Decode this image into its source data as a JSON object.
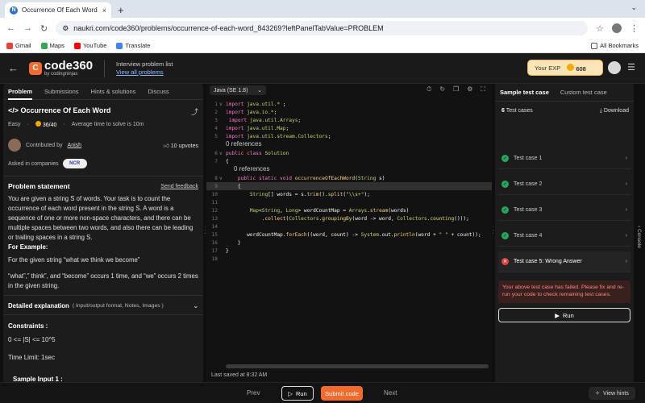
{
  "browser": {
    "tab_title": "Occurrence Of Each Word - N",
    "tab_close": "×",
    "new_tab": "+",
    "url": "naukri.com/code360/problems/occurrence-of-each-word_843269?leftPanelTabValue=PROBLEM",
    "bookmarks": [
      {
        "label": "Gmail",
        "color": "#ea4335"
      },
      {
        "label": "Maps",
        "color": "#34a853"
      },
      {
        "label": "YouTube",
        "color": "#ff0000"
      },
      {
        "label": "Translate",
        "color": "#4285f4"
      }
    ],
    "all_bookmarks": "All Bookmarks"
  },
  "app": {
    "logo_mark": "C",
    "logo_word": "code360",
    "logo_sub": "by codingninjas",
    "interview_list": "Interview problem list",
    "view_all": "View all problems",
    "exp_label": "Your EXP",
    "exp_value": "608"
  },
  "left": {
    "tabs": [
      "Problem",
      "Submissions",
      "Hints & solutions",
      "Discuss"
    ],
    "title": "Occurrence Of Each Word",
    "difficulty": "Easy",
    "score": "36/40",
    "avg_time": "Average time to solve is 10m",
    "contributed_by": "Contributed by",
    "contributor": "Anish",
    "upvotes": "10 upvotes",
    "asked_in": "Asked in companies",
    "company": "NCR",
    "statement_heading": "Problem statement",
    "send_feedback": "Send feedback",
    "statement": "You are given a string S of words. Your task is to count the occurrence of each word present in the string S. A word is a sequence of one or more non-space characters, and there can be multiple spaces between two words, and also there can be leading or trailing spaces in a string S.",
    "example_heading": "For Example:",
    "example_line": "For the given string  “what we think we become”",
    "example_result": "“what”,” think”, and “become” occurs 1 time, and “we” occurs 2 times in the given string.",
    "detailed": "Detailed explanation",
    "detailed_sub": "( Input/output format, Notes, Images )",
    "constraints_heading": "Constraints :",
    "constraint": "0 <= |S| <= 10^5",
    "time_limit": "Time Limit: 1sec",
    "sample_input": "Sample Input 1 :"
  },
  "editor": {
    "language": "Java (SE 1.8)",
    "references_label": "0 references",
    "saved": "Last saved at 8:32 AM",
    "lines": [
      {
        "n": "1",
        "html_parts": [
          [
            "kw",
            "import "
          ],
          [
            "ty",
            "java.util.* "
          ],
          [
            "pl",
            ";"
          ]
        ],
        "fold": "v"
      },
      {
        "n": "2",
        "html_parts": [
          [
            "kw",
            "import "
          ],
          [
            "ty",
            "java.io.*"
          ],
          [
            "pl",
            ";"
          ]
        ]
      },
      {
        "n": "3",
        "html_parts": [
          [
            "kw",
            " import "
          ],
          [
            "ty",
            "java.util.Arrays"
          ],
          [
            "pl",
            ";"
          ]
        ]
      },
      {
        "n": "4",
        "html_parts": [
          [
            "kw",
            "import "
          ],
          [
            "ty",
            "java.util.Map"
          ],
          [
            "pl",
            ";"
          ]
        ]
      },
      {
        "n": "5",
        "html_parts": [
          [
            "kw",
            "import "
          ],
          [
            "ty",
            "java.util.stream.Collectors"
          ],
          [
            "pl",
            ";"
          ]
        ]
      },
      {
        "n": "6",
        "html_parts": [
          [
            "kw",
            "public class "
          ],
          [
            "ty",
            "Solution"
          ]
        ],
        "fold": "v",
        "ref_before": true
      },
      {
        "n": "7",
        "html_parts": [
          [
            "pl",
            "{"
          ]
        ]
      },
      {
        "n": "8",
        "html_parts": [
          [
            "pl",
            "    "
          ],
          [
            "kw",
            "public static void "
          ],
          [
            "fn",
            "occurrenceOfEachWord"
          ],
          [
            "pl",
            "("
          ],
          [
            "ty",
            "String "
          ],
          [
            "pl",
            "s)"
          ]
        ],
        "fold": "v",
        "ref_before": true,
        "ref_indent": true
      },
      {
        "n": "9",
        "html_parts": [
          [
            "pl",
            "    {"
          ]
        ],
        "hl": true
      },
      {
        "n": "10",
        "html_parts": [
          [
            "pl",
            "        "
          ],
          [
            "ty",
            "String"
          ],
          [
            "pl",
            "[] words = s."
          ],
          [
            "fn",
            "trim"
          ],
          [
            "pl",
            "()."
          ],
          [
            "fn",
            "split"
          ],
          [
            "pl",
            "("
          ],
          [
            "st",
            "\"\\\\s+\""
          ],
          [
            "pl",
            ");"
          ]
        ]
      },
      {
        "n": "11",
        "html_parts": [
          [
            "pl",
            ""
          ]
        ]
      },
      {
        "n": "12",
        "html_parts": [
          [
            "pl",
            "        "
          ],
          [
            "ty",
            "Map"
          ],
          [
            "pl",
            "<"
          ],
          [
            "ty",
            "String"
          ],
          [
            "pl",
            ", "
          ],
          [
            "ty",
            "Long"
          ],
          [
            "pl",
            "> wordCountMap = "
          ],
          [
            "ty",
            "Arrays"
          ],
          [
            "pl",
            "."
          ],
          [
            "fn",
            "stream"
          ],
          [
            "pl",
            "(words)"
          ]
        ]
      },
      {
        "n": "13",
        "html_parts": [
          [
            "pl",
            "            ."
          ],
          [
            "fn",
            "collect"
          ],
          [
            "pl",
            "("
          ],
          [
            "ty",
            "Collectors"
          ],
          [
            "pl",
            "."
          ],
          [
            "fn",
            "groupingBy"
          ],
          [
            "pl",
            "(word -> word, "
          ],
          [
            "ty",
            "Collectors"
          ],
          [
            "pl",
            "."
          ],
          [
            "fn",
            "counting"
          ],
          [
            "pl",
            "()));"
          ]
        ]
      },
      {
        "n": "14",
        "html_parts": [
          [
            "pl",
            ""
          ]
        ]
      },
      {
        "n": "15",
        "html_parts": [
          [
            "pl",
            "       wordCountMap."
          ],
          [
            "fn",
            "forEach"
          ],
          [
            "pl",
            "((word, count) -> "
          ],
          [
            "ty",
            "System"
          ],
          [
            "pl",
            ".out."
          ],
          [
            "fn",
            "println"
          ],
          [
            "pl",
            "(word + "
          ],
          [
            "st",
            "\" \""
          ],
          [
            "pl",
            " + count));"
          ]
        ]
      },
      {
        "n": "16",
        "html_parts": [
          [
            "pl",
            "    }"
          ]
        ]
      },
      {
        "n": "17",
        "html_parts": [
          [
            "pl",
            "}"
          ]
        ]
      },
      {
        "n": "18",
        "html_parts": [
          [
            "pl",
            ""
          ]
        ]
      }
    ]
  },
  "right": {
    "tabs": [
      "Sample test case",
      "Custom test case"
    ],
    "count": "6",
    "count_label": "Test cases",
    "download": "Download",
    "cases": [
      {
        "label": "Test case 1",
        "status": "pass"
      },
      {
        "label": "Test case 2",
        "status": "pass"
      },
      {
        "label": "Test case 3",
        "status": "pass"
      },
      {
        "label": "Test case 4",
        "status": "pass"
      },
      {
        "label": "Test case 5:  Wrong Answer",
        "status": "fail"
      }
    ],
    "fail_message": "Your above test case has failed. Please fix and re-run your code to check remaining test cases.",
    "run": "Run",
    "console": "Console"
  },
  "bottom": {
    "prev": "Prev",
    "run": "Run",
    "submit": "Submit code",
    "next": "Next",
    "hints": "View hints"
  }
}
